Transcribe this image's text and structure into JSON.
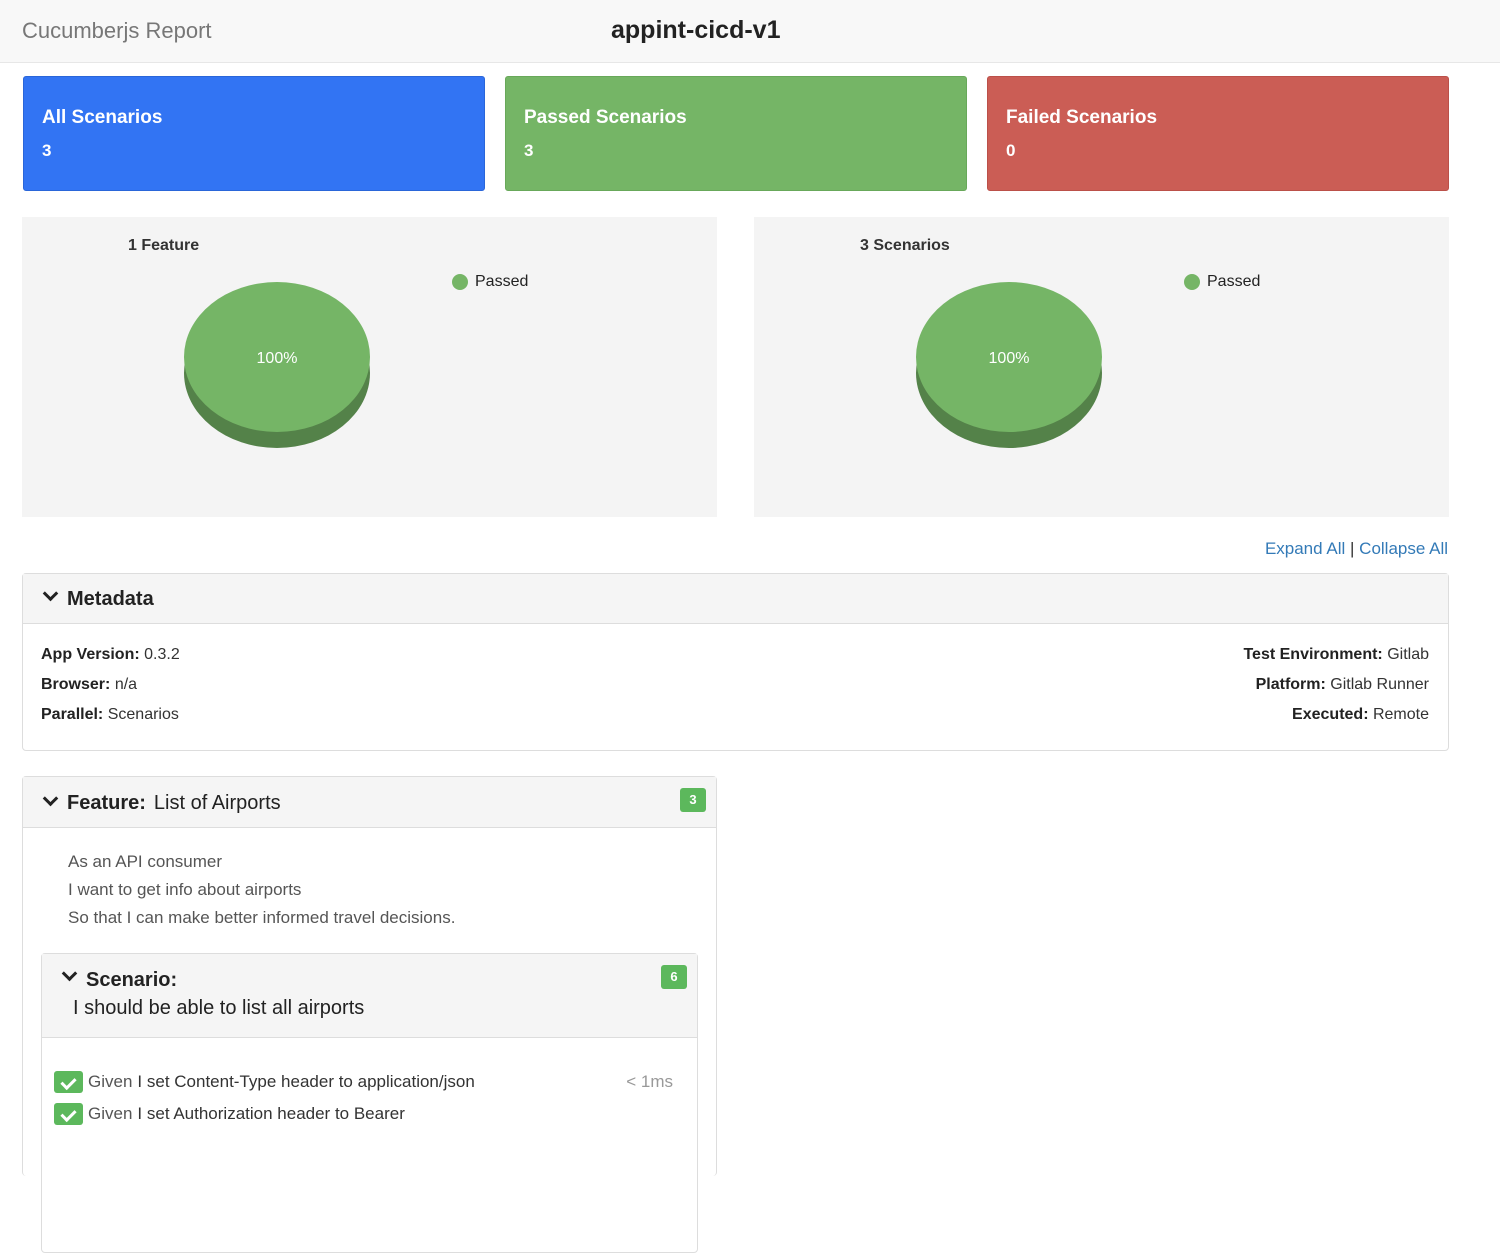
{
  "header": {
    "brand": "Cucumberjs Report",
    "project": "appint-cicd-v1"
  },
  "cards": {
    "all": {
      "title": "All Scenarios",
      "value": "3",
      "color": "#3274f3"
    },
    "passed": {
      "title": "Passed Scenarios",
      "value": "3",
      "color": "#75b566"
    },
    "failed": {
      "title": "Failed Scenarios",
      "value": "0",
      "color": "#cb5d55"
    }
  },
  "chart_data": [
    {
      "type": "pie",
      "title": "1 Feature",
      "categories": [
        "Passed"
      ],
      "values": [
        100
      ],
      "labels": [
        "100%"
      ],
      "colors": [
        "#75b566"
      ],
      "legend": "top-right"
    },
    {
      "type": "pie",
      "title": "3 Scenarios",
      "categories": [
        "Passed"
      ],
      "values": [
        100
      ],
      "labels": [
        "100%"
      ],
      "colors": [
        "#75b566"
      ],
      "legend": "top-right"
    }
  ],
  "toggles": {
    "expand": "Expand All",
    "separator": "|",
    "collapse": "Collapse All"
  },
  "metadata": {
    "title": "Metadata",
    "left": [
      {
        "label": "App Version:",
        "value": "0.3.2"
      },
      {
        "label": "Browser:",
        "value": "n/a"
      },
      {
        "label": "Parallel:",
        "value": "Scenarios"
      }
    ],
    "right": [
      {
        "label": "Test Environment:",
        "value": "Gitlab"
      },
      {
        "label": "Platform:",
        "value": "Gitlab Runner"
      },
      {
        "label": "Executed:",
        "value": "Remote"
      }
    ]
  },
  "feature": {
    "keyword": "Feature:",
    "name": "List of Airports",
    "count": "3",
    "description": [
      "As an API consumer",
      "I want to get info about airports",
      "So that I can make better informed travel decisions."
    ],
    "scenario": {
      "keyword": "Scenario:",
      "name": "I should be able to list all airports",
      "count": "6",
      "steps": [
        {
          "keyword": "Given",
          "text": "I set Content-Type header to application/json",
          "duration": "< 1ms"
        },
        {
          "keyword": "Given",
          "text": "I set Authorization header to Bearer",
          "duration": ""
        }
      ]
    }
  }
}
